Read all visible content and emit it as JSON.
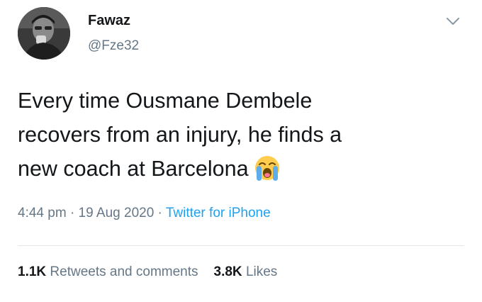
{
  "tweet": {
    "author": {
      "display_name": "Fawaz",
      "handle": "@Fze32"
    },
    "menu_icon": "chevron-down-icon",
    "text_lines": [
      "Every time Ousmane Dembele",
      "recovers from an injury, he finds a",
      "new coach at Barcelona"
    ],
    "emoji_icon": "loudly-crying-face-emoji",
    "time": "4:44 pm",
    "date": "19 Aug 2020",
    "separator": "·",
    "source": "Twitter for iPhone",
    "stats": {
      "retweets_count": "1.1K",
      "retweets_label": "Retweets and comments",
      "likes_count": "3.8K",
      "likes_label": "Likes"
    }
  },
  "colors": {
    "text": "#14171a",
    "secondary": "#657786",
    "link": "#1da1f2",
    "divider": "#e1e8ed"
  }
}
